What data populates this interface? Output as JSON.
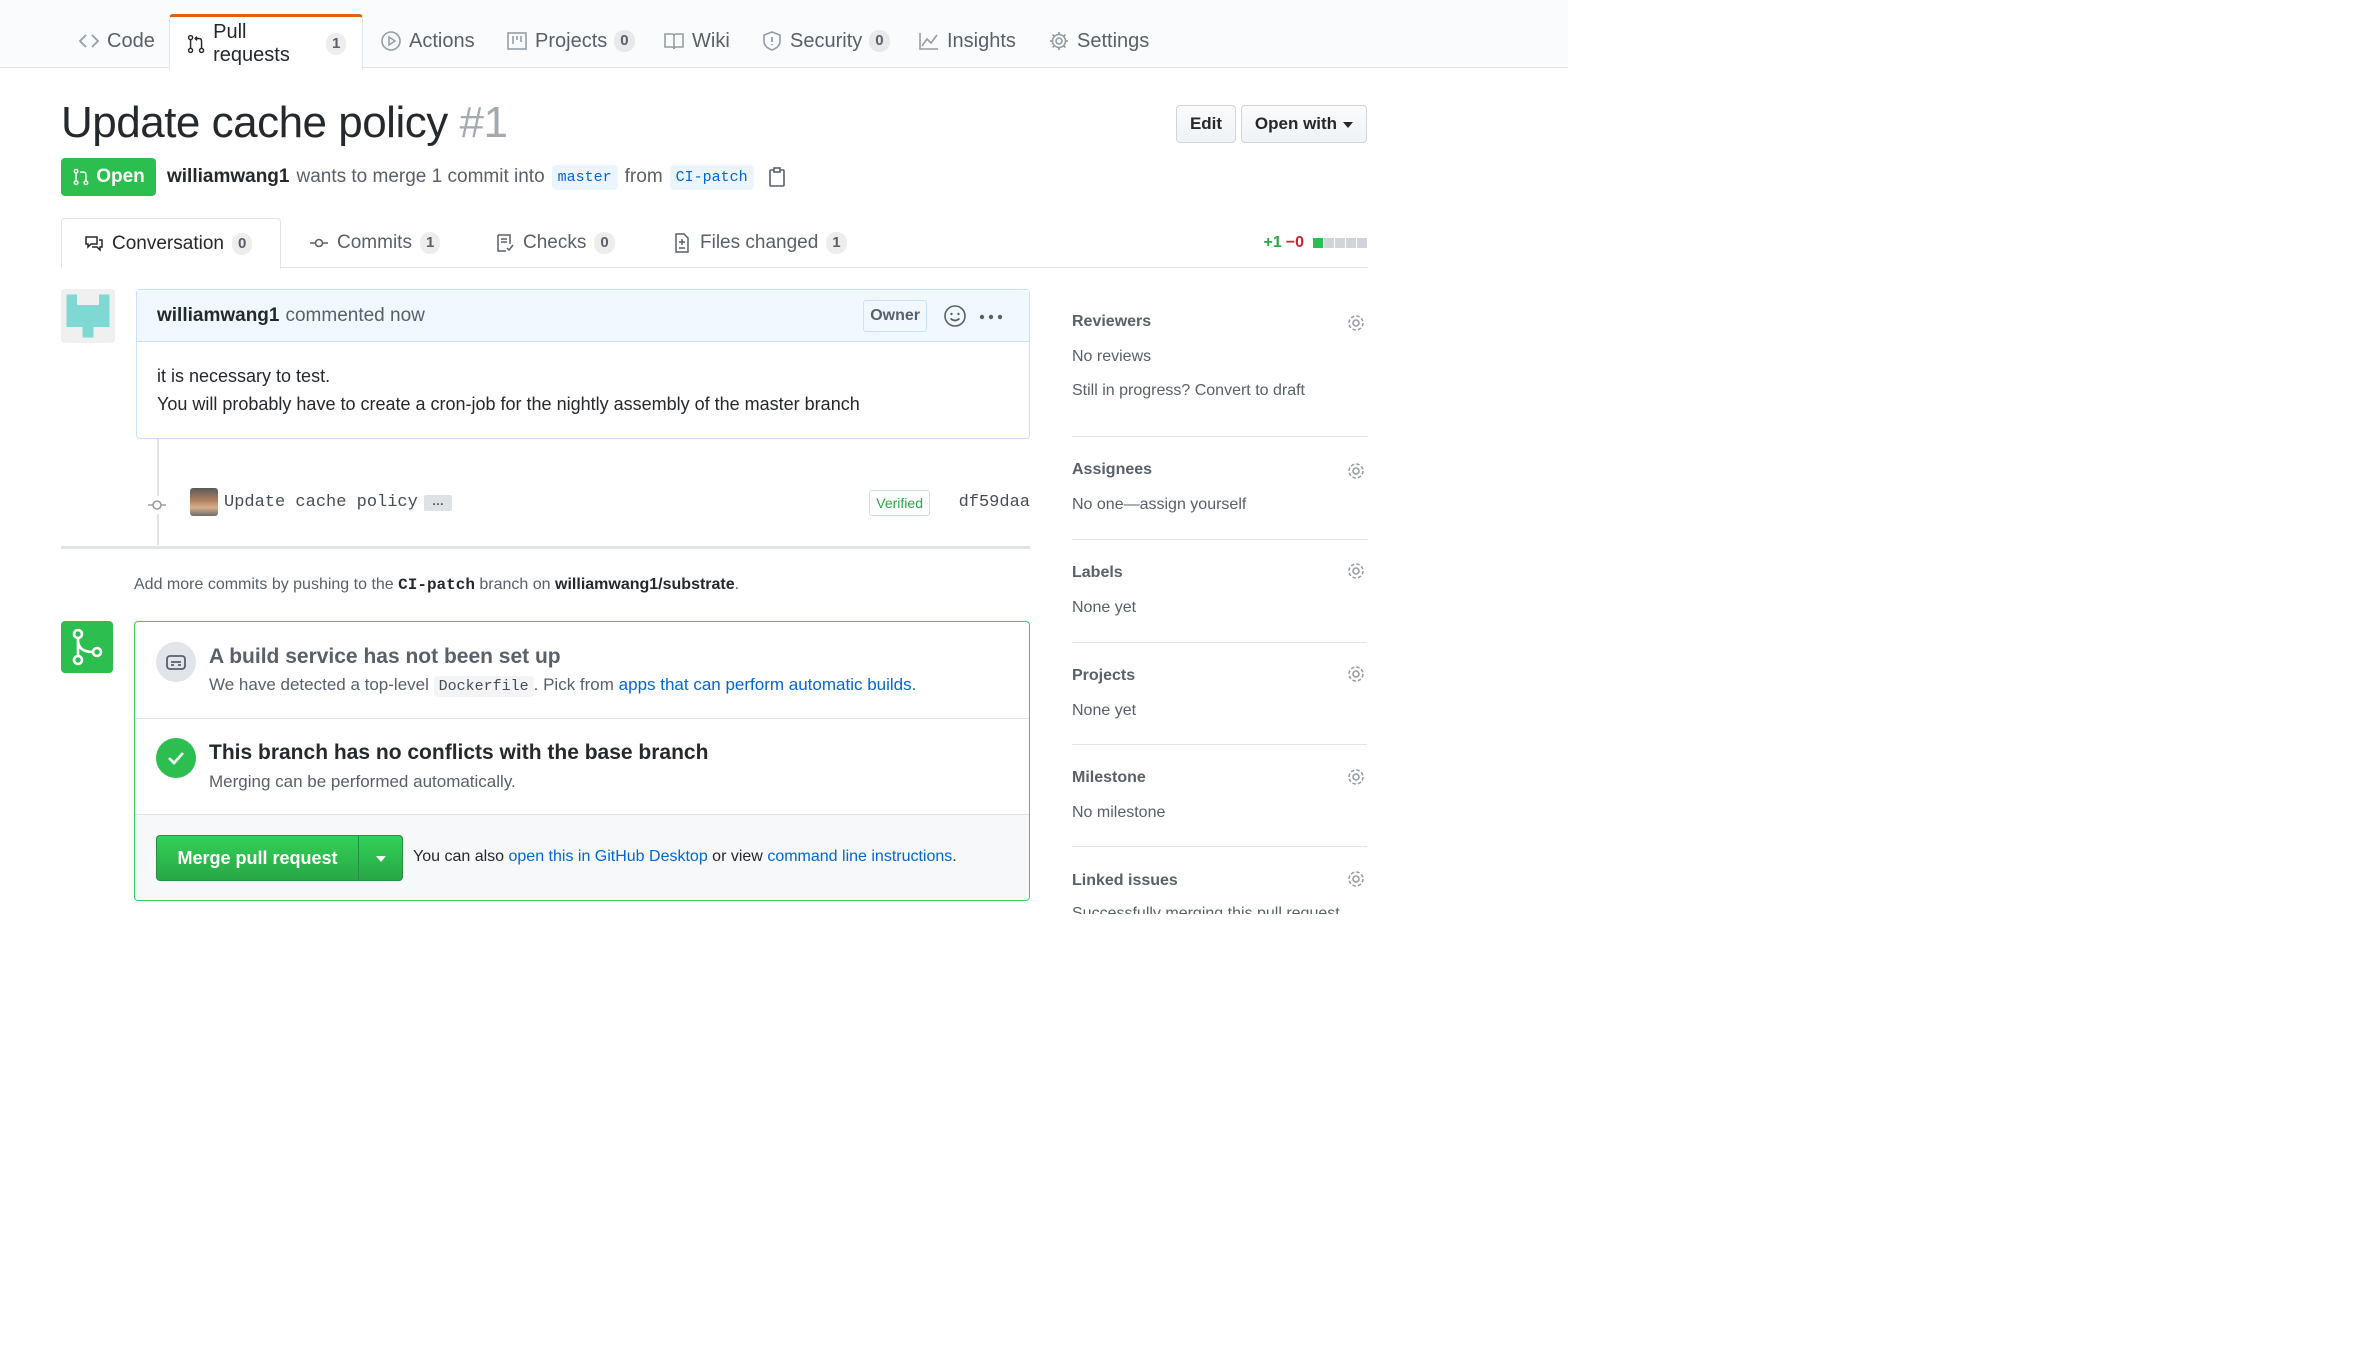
{
  "repo_tabs": [
    {
      "label": "Code",
      "count": null
    },
    {
      "label": "Pull requests",
      "count": "1"
    },
    {
      "label": "Actions",
      "count": null
    },
    {
      "label": "Projects",
      "count": "0"
    },
    {
      "label": "Wiki",
      "count": null
    },
    {
      "label": "Security",
      "count": "0"
    },
    {
      "label": "Insights",
      "count": null
    },
    {
      "label": "Settings",
      "count": null
    }
  ],
  "pr": {
    "title": "Update cache policy",
    "number": "#1",
    "state": "Open",
    "author": "williamwang1",
    "merge_text": "wants to merge 1 commit into",
    "base_branch": "master",
    "from_text": "from",
    "head_branch": "CI-patch"
  },
  "header_buttons": {
    "edit": "Edit",
    "open_with": "Open with"
  },
  "pr_tabs": [
    {
      "label": "Conversation",
      "count": "0"
    },
    {
      "label": "Commits",
      "count": "1"
    },
    {
      "label": "Checks",
      "count": "0"
    },
    {
      "label": "Files changed",
      "count": "1"
    }
  ],
  "diffstat": {
    "additions": "+1",
    "deletions": "−0",
    "blocks": [
      "green",
      "grey",
      "grey",
      "grey",
      "grey"
    ]
  },
  "comment": {
    "author": "williamwang1",
    "time": "commented now",
    "badge": "Owner",
    "line1": "it is necessary to test.",
    "line2": "You will probably have to create a cron-job for the nightly assembly of the master branch"
  },
  "commit": {
    "message": "Update cache policy",
    "ellipsis": "…",
    "verified": "Verified",
    "sha": "df59daa"
  },
  "push_note": {
    "prefix": "Add more commits by pushing to the",
    "branch": "CI-patch",
    "middle": "branch on",
    "repo": "williamwang1/substrate",
    "suffix": "."
  },
  "merge_box": {
    "build_title": "A build service has not been set up",
    "build_desc_prefix": "We have detected a top-level",
    "build_file": "Dockerfile",
    "build_desc_mid": ". Pick from",
    "build_link": "apps that can perform automatic builds.",
    "conflict_title": "This branch has no conflicts with the base branch",
    "conflict_desc": "Merging can be performed automatically.",
    "merge_button": "Merge pull request",
    "foot_prefix": "You can also",
    "foot_link1": "open this in GitHub Desktop",
    "foot_mid": "or view",
    "foot_link2": "command line instructions",
    "foot_suffix": "."
  },
  "sidebar": {
    "reviewers": {
      "title": "Reviewers",
      "line1": "No reviews",
      "line2": "Still in progress? Convert to draft"
    },
    "assignees": {
      "title": "Assignees",
      "line1": "No one—assign yourself"
    },
    "labels": {
      "title": "Labels",
      "line1": "None yet"
    },
    "projects": {
      "title": "Projects",
      "line1": "None yet"
    },
    "milestone": {
      "title": "Milestone",
      "line1": "No milestone"
    },
    "linked_issues": {
      "title": "Linked issues",
      "line1": "Successfully merging this pull request"
    }
  },
  "colors": {
    "accent_tab": "#e36209",
    "open_green": "#2cbe4e",
    "link_blue": "#0366d6"
  }
}
